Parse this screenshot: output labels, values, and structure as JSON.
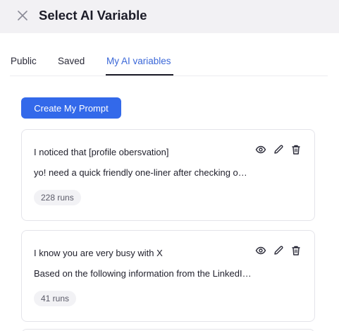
{
  "header": {
    "title": "Select AI Variable",
    "close_icon": "close-icon"
  },
  "tabs": [
    {
      "label": "Public",
      "active": false
    },
    {
      "label": "Saved",
      "active": false
    },
    {
      "label": "My AI variables",
      "active": true
    }
  ],
  "create_button_label": "Create My Prompt",
  "colors": {
    "accent": "#3369ea",
    "active_tab": "#3a67d8",
    "header_bg": "#f2f1f4"
  },
  "cards": [
    {
      "title": "I noticed that [profile obersvation]",
      "description": "yo! need a quick friendly one-liner after checking out their profile",
      "runs": "228 runs",
      "icons": [
        "eye-icon",
        "pencil-icon",
        "trash-icon"
      ]
    },
    {
      "title": "I know you are very busy with X",
      "description": "Based on the following information from the LinkedIn profile",
      "runs": "41 runs",
      "icons": [
        "eye-icon",
        "pencil-icon",
        "trash-icon"
      ]
    }
  ]
}
